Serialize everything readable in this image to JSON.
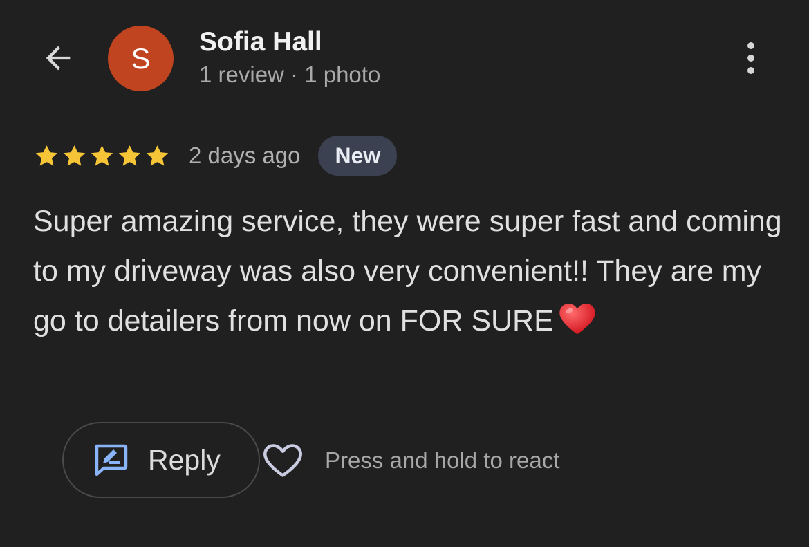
{
  "reviewer": {
    "initial": "S",
    "name": "Sofia Hall",
    "meta": "1 review · 1 photo",
    "avatar_color": "#c0441f"
  },
  "review": {
    "rating": 5,
    "rating_max": 5,
    "star_color": "#f5c437",
    "time_ago": "2 days ago",
    "badge": "New",
    "text": "Super amazing service, they were super fast and coming to my driveway was also very convenient!! They are my go to detailers from now on FOR SURE",
    "emoji_icon": "red-heart-emoji"
  },
  "actions": {
    "reply_label": "Reply",
    "react_hint": "Press and hold to react",
    "reply_icon": "rate-review-icon",
    "react_icon": "heart-outline-icon",
    "accent_color": "#8ab4f8"
  },
  "header": {
    "back_icon": "arrow-back-icon",
    "more_icon": "more-vert-icon"
  }
}
